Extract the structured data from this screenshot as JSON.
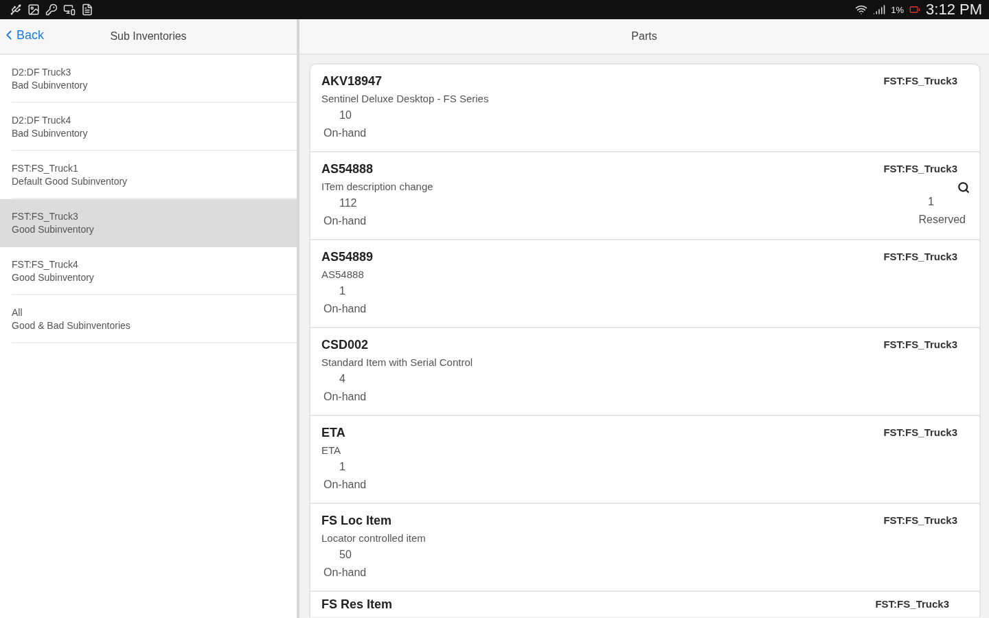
{
  "status_bar": {
    "battery": "1%",
    "time": "3:12 PM"
  },
  "sidebar": {
    "back": "Back",
    "title": "Sub Inventories",
    "items": [
      {
        "name": "D2:DF Truck3",
        "type": "Bad Subinventory",
        "selected": false
      },
      {
        "name": "D2:DF Truck4",
        "type": "Bad Subinventory",
        "selected": false
      },
      {
        "name": "FST:FS_Truck1",
        "type": "Default Good Subinventory",
        "selected": false
      },
      {
        "name": "FST:FS_Truck3",
        "type": "Good Subinventory",
        "selected": true
      },
      {
        "name": "FST:FS_Truck4",
        "type": "Good Subinventory",
        "selected": false
      },
      {
        "name": "All",
        "type": "Good & Bad Subinventories",
        "selected": false
      }
    ]
  },
  "parts": {
    "title": "Parts",
    "items": [
      {
        "code": "AKV18947",
        "location": "FST:FS_Truck3",
        "description": "Sentinel Deluxe Desktop - FS Series",
        "quantity": "10",
        "quantity_label": "On-hand"
      },
      {
        "code": "AS54888",
        "location": "FST:FS_Truck3",
        "description": "ITem description change",
        "quantity": "112",
        "quantity_label": "On-hand",
        "reserved": {
          "quantity": "1",
          "label": "Reserved"
        }
      },
      {
        "code": "AS54889",
        "location": "FST:FS_Truck3",
        "description": "AS54888",
        "quantity": "1",
        "quantity_label": "On-hand"
      },
      {
        "code": "CSD002",
        "location": "FST:FS_Truck3",
        "description": "Standard Item with Serial Control",
        "quantity": "4",
        "quantity_label": "On-hand"
      },
      {
        "code": "ETA",
        "location": "FST:FS_Truck3",
        "description": "ETA",
        "quantity": "1",
        "quantity_label": "On-hand"
      },
      {
        "code": "FS Loc Item",
        "location": "FST:FS_Truck3",
        "description": "Locator controlled item",
        "quantity": "50",
        "quantity_label": "On-hand"
      },
      {
        "code": "FS Res Item",
        "location": "FST:FS_Truck3"
      }
    ]
  }
}
